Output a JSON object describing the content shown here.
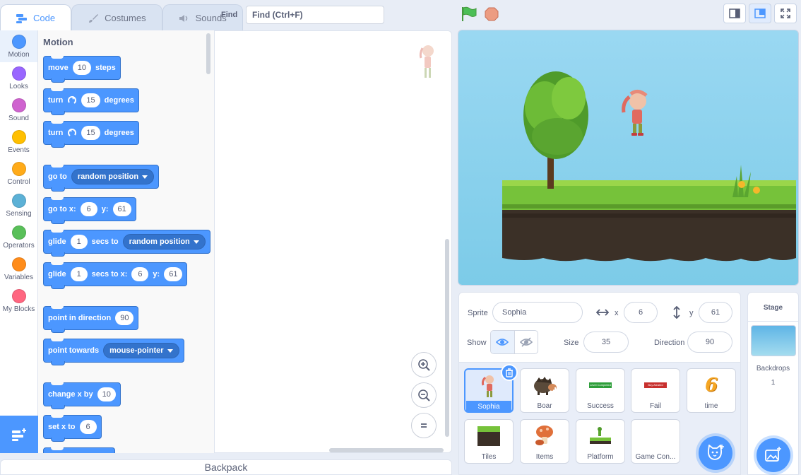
{
  "tabs": [
    {
      "label": "Code",
      "icon": "code-icon"
    },
    {
      "label": "Costumes",
      "icon": "brush-icon"
    },
    {
      "label": "Sounds",
      "icon": "speaker-icon"
    }
  ],
  "find": {
    "label": "Find",
    "placeholder": "Find (Ctrl+F)"
  },
  "categories": [
    {
      "label": "Motion",
      "color": "#4c97ff"
    },
    {
      "label": "Looks",
      "color": "#9966ff"
    },
    {
      "label": "Sound",
      "color": "#cf63cf"
    },
    {
      "label": "Events",
      "color": "#ffbf00"
    },
    {
      "label": "Control",
      "color": "#ffab19"
    },
    {
      "label": "Sensing",
      "color": "#5cb1d6"
    },
    {
      "label": "Operators",
      "color": "#59c059"
    },
    {
      "label": "Variables",
      "color": "#ff8c1a"
    },
    {
      "label": "My Blocks",
      "color": "#ff6680"
    }
  ],
  "palette": {
    "title": "Motion",
    "blocks": {
      "move": {
        "t1": "move",
        "v1": "10",
        "t2": "steps"
      },
      "turn_right": {
        "t1": "turn",
        "v1": "15",
        "t2": "degrees"
      },
      "turn_left": {
        "t1": "turn",
        "v1": "15",
        "t2": "degrees"
      },
      "goto": {
        "t1": "go to",
        "d1": "random position"
      },
      "goto_xy": {
        "t1": "go to x:",
        "v1": "6",
        "t2": "y:",
        "v2": "61"
      },
      "glide_to": {
        "t1": "glide",
        "v1": "1",
        "t2": "secs to",
        "d1": "random position"
      },
      "glide_xy": {
        "t1": "glide",
        "v1": "1",
        "t2": "secs to x:",
        "v2": "6",
        "t3": "y:",
        "v3": "61"
      },
      "point_dir": {
        "t1": "point in direction",
        "v1": "90"
      },
      "point_towards": {
        "t1": "point towards",
        "d1": "mouse-pointer"
      },
      "change_x": {
        "t1": "change x by",
        "v1": "10"
      },
      "set_x": {
        "t1": "set x to",
        "v1": "6"
      }
    }
  },
  "backpack": {
    "label": "Backpack"
  },
  "sprite_info": {
    "sprite_label": "Sprite",
    "sprite_name": "Sophia",
    "x_label": "x",
    "x_value": "6",
    "y_label": "y",
    "y_value": "61",
    "show_label": "Show",
    "size_label": "Size",
    "size_value": "35",
    "direction_label": "Direction",
    "direction_value": "90"
  },
  "sprites": [
    {
      "name": "Sophia",
      "selected": true
    },
    {
      "name": "Boar"
    },
    {
      "name": "Success"
    },
    {
      "name": "Fail"
    },
    {
      "name": "time"
    },
    {
      "name": "Tiles"
    },
    {
      "name": "Items"
    },
    {
      "name": "Platform"
    },
    {
      "name": "Game Con..."
    }
  ],
  "sprite_thumb_text": {
    "success": "Level Completed",
    "fail": "Boy Aleated",
    "time": "6"
  },
  "stage_panel": {
    "title": "Stage",
    "backdrops_label": "Backdrops",
    "backdrops_count": "1"
  },
  "colors": {
    "accent": "#4c97ff",
    "motion_block": "#4c97ff",
    "stage_sky": "#8fd3ef"
  }
}
